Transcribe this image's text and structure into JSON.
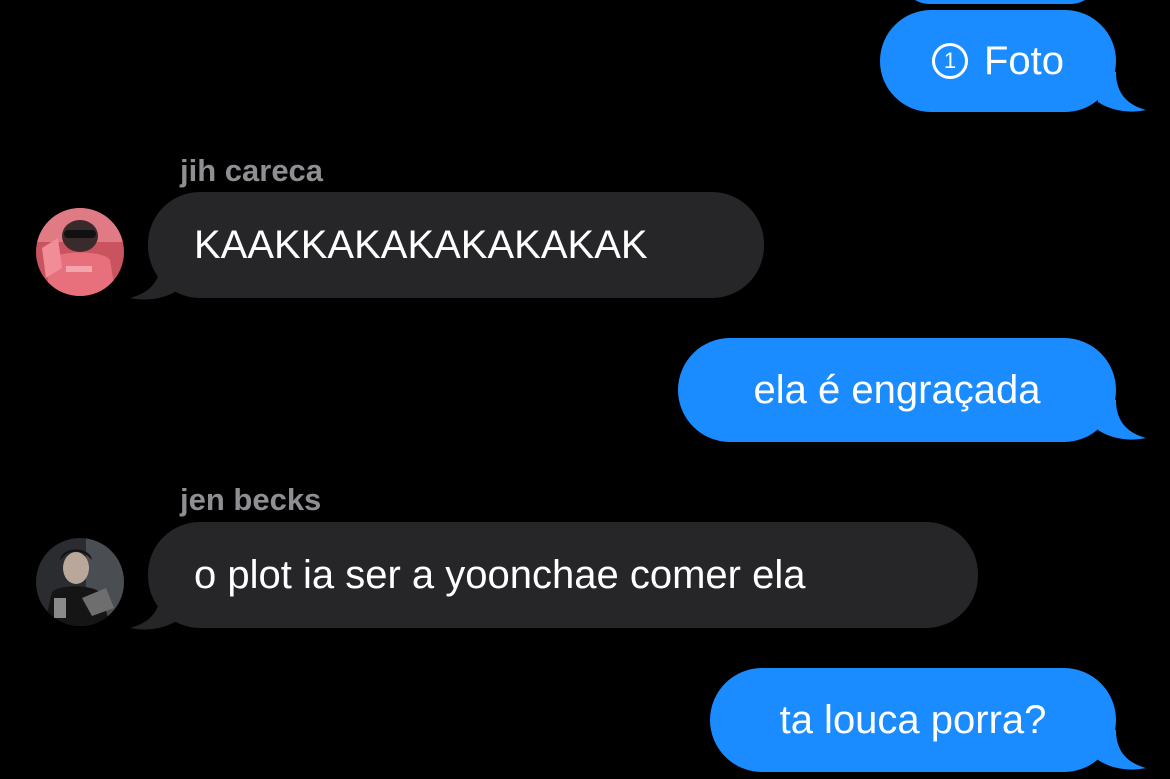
{
  "colors": {
    "background": "#000000",
    "outgoing_bubble": "#1a8cff",
    "incoming_bubble": "#262628",
    "sender_name": "#8e8e93",
    "text": "#ffffff"
  },
  "messages": [
    {
      "direction": "outgoing",
      "icon": "circled-1-icon",
      "icon_glyph": "1",
      "text": "Foto"
    },
    {
      "direction": "incoming",
      "sender": "jih careca",
      "avatar": "pink-hoodie-avatar",
      "text": "KAAKKAKAKAKAKAKAK"
    },
    {
      "direction": "outgoing",
      "text": "ela é engraçada"
    },
    {
      "direction": "incoming",
      "sender": "jen becks",
      "avatar": "dark-portrait-avatar",
      "text": "o plot ia ser a yoonchae comer ela"
    },
    {
      "direction": "outgoing",
      "text": "ta louca porra?"
    }
  ]
}
